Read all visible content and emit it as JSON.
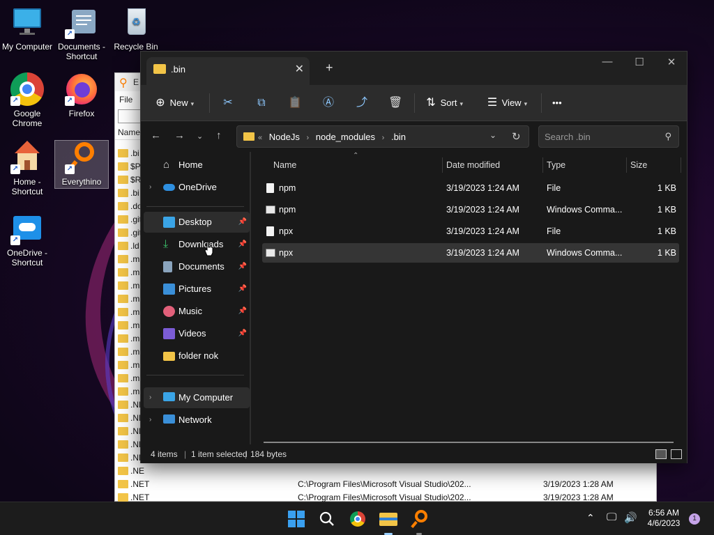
{
  "desktop": {
    "icons": [
      {
        "label": "My Computer",
        "icon": "monitor-icon"
      },
      {
        "label": "Documents - Shortcut",
        "icon": "documents-icon"
      },
      {
        "label": "Recycle Bin",
        "icon": "recycle-bin-icon"
      },
      {
        "label": "Google Chrome",
        "icon": "chrome-icon"
      },
      {
        "label": "Firefox",
        "icon": "firefox-icon"
      },
      {
        "label": "Home - Shortcut",
        "icon": "home-icon"
      },
      {
        "label": "Everythino",
        "icon": "everything-search-icon"
      },
      {
        "label": "OneDrive - Shortcut",
        "icon": "onedrive-icon"
      }
    ]
  },
  "everything_window": {
    "title_letter": "E",
    "menu_first": "File",
    "column_name": "Name",
    "rows": [
      {
        "name": ".bi",
        "path": "",
        "date": ""
      },
      {
        "name": "$P",
        "path": "",
        "date": ""
      },
      {
        "name": "$R",
        "path": "",
        "date": ""
      },
      {
        "name": ".bi",
        "path": "",
        "date": ""
      },
      {
        "name": ".do",
        "path": "",
        "date": ""
      },
      {
        "name": ".git",
        "path": "",
        "date": ""
      },
      {
        "name": ".git",
        "path": "",
        "date": ""
      },
      {
        "name": ".ld",
        "path": "",
        "date": ""
      },
      {
        "name": ".m",
        "path": "",
        "date": ""
      },
      {
        "name": ".m",
        "path": "",
        "date": ""
      },
      {
        "name": ".m",
        "path": "",
        "date": ""
      },
      {
        "name": ".m",
        "path": "",
        "date": ""
      },
      {
        "name": ".m",
        "path": "",
        "date": ""
      },
      {
        "name": ".m",
        "path": "",
        "date": ""
      },
      {
        "name": ".m",
        "path": "",
        "date": ""
      },
      {
        "name": ".m",
        "path": "",
        "date": ""
      },
      {
        "name": ".m",
        "path": "",
        "date": ""
      },
      {
        "name": ".m",
        "path": "",
        "date": ""
      },
      {
        "name": ".m",
        "path": "",
        "date": ""
      },
      {
        "name": ".NE",
        "path": "",
        "date": ""
      },
      {
        "name": ".NE",
        "path": "",
        "date": ""
      },
      {
        "name": ".NE",
        "path": "",
        "date": ""
      },
      {
        "name": ".NE",
        "path": "",
        "date": ""
      },
      {
        "name": ".NE",
        "path": "",
        "date": ""
      },
      {
        "name": ".NE",
        "path": "",
        "date": ""
      },
      {
        "name": ".NET",
        "path": "C:\\Program Files\\Microsoft Visual Studio\\202...",
        "date": "3/19/2023 1:28 AM"
      },
      {
        "name": ".NET",
        "path": "C:\\Program Files\\Microsoft Visual Studio\\202...",
        "date": "3/19/2023 1:28 AM"
      },
      {
        "name": ".NET",
        "path": "C:\\Program Files\\Microsoft Visual Studio\\202...",
        "date": "3/19/2023 1:28 AM"
      }
    ]
  },
  "explorer": {
    "tab_title": ".bin",
    "new_tab": "+",
    "window_controls": {
      "minimize": "—",
      "maximize": "☐",
      "close": "✕"
    },
    "toolbar": {
      "new_label": "New",
      "sort_label": "Sort",
      "view_label": "View",
      "more_label": "•••"
    },
    "address": {
      "overflow": "«",
      "crumbs": [
        "NodeJs",
        "node_modules",
        ".bin"
      ]
    },
    "search": {
      "placeholder": "Search .bin"
    },
    "nav": {
      "home": "Home",
      "onedrive": "OneDrive",
      "quick": [
        {
          "label": "Desktop",
          "pinned": true
        },
        {
          "label": "Downloads",
          "pinned": true
        },
        {
          "label": "Documents",
          "pinned": true
        },
        {
          "label": "Pictures",
          "pinned": true
        },
        {
          "label": "Music",
          "pinned": true
        },
        {
          "label": "Videos",
          "pinned": true
        },
        {
          "label": "folder nok",
          "pinned": false
        }
      ],
      "my_computer": "My Computer",
      "network": "Network"
    },
    "columns": {
      "name": "Name",
      "date": "Date modified",
      "type": "Type",
      "size": "Size"
    },
    "files": [
      {
        "name": "npm",
        "date": "3/19/2023 1:24 AM",
        "type": "File",
        "size": "1 KB",
        "icon": "file-icon"
      },
      {
        "name": "npm",
        "date": "3/19/2023 1:24 AM",
        "type": "Windows Comma...",
        "size": "1 KB",
        "icon": "cmd-file-icon"
      },
      {
        "name": "npx",
        "date": "3/19/2023 1:24 AM",
        "type": "File",
        "size": "1 KB",
        "icon": "file-icon"
      },
      {
        "name": "npx",
        "date": "3/19/2023 1:24 AM",
        "type": "Windows Comma...",
        "size": "1 KB",
        "icon": "cmd-file-icon",
        "selected": true
      }
    ],
    "status": {
      "items": "4 items",
      "selected": "1 item selected",
      "size": "184 bytes"
    }
  },
  "taskbar": {
    "clock_time": "6:56 AM",
    "clock_date": "4/6/2023",
    "notification_count": "1"
  }
}
